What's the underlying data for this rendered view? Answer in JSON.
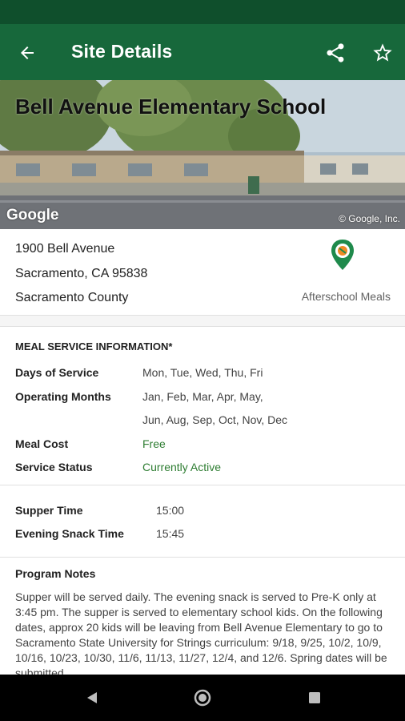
{
  "app_bar": {
    "title": "Site Details",
    "back_icon": "arrow-back-icon",
    "share_icon": "share-icon",
    "favorite_icon": "star-outline-icon",
    "color": "#17683b",
    "status_color": "#0f4f2c"
  },
  "hero": {
    "school_name": "Bell Avenue Elementary School",
    "google_logo": "Google",
    "copyright": "© Google, Inc."
  },
  "address": {
    "street": "1900 Bell Avenue",
    "city_state_zip": "Sacramento, CA 95838",
    "county": "Sacramento County",
    "program_icon": "afterschool-meals-icon",
    "program_label": "Afterschool Meals"
  },
  "meal_service": {
    "heading": "MEAL SERVICE INFORMATION*",
    "days_label": "Days of Service",
    "days_value": "Mon, Tue, Wed, Thu, Fri",
    "months_label": "Operating Months",
    "months_value_line1": "Jan, Feb, Mar, Apr, May,",
    "months_value_line2": "Jun, Aug, Sep, Oct, Nov, Dec",
    "cost_label": "Meal Cost",
    "cost_value": "Free",
    "status_label": "Service Status",
    "status_value": "Currently Active",
    "value_accent": "#2e7d32"
  },
  "times": {
    "supper_label": "Supper Time",
    "supper_value": "15:00",
    "snack_label": "Evening Snack Time",
    "snack_value": "15:45"
  },
  "notes": {
    "heading": "Program Notes",
    "body": "Supper will be served daily. The evening snack is served to Pre-K only at 3:45 pm. The supper is served to elementary school kids. On the following dates, approx 20 kids will be leaving from Bell Avenue Elementary to go to Sacramento State University for Strings curriculum: 9/18, 9/25, 10/2, 10/9, 10/16, 10/23, 10/30, 11/6, 11/13, 11/27, 12/4, and 12/6. Spring dates will be submitted"
  },
  "nav_bar": {
    "back_icon": "nav-back-triangle-icon",
    "home_icon": "nav-home-circle-icon",
    "recents_icon": "nav-recents-square-icon"
  }
}
